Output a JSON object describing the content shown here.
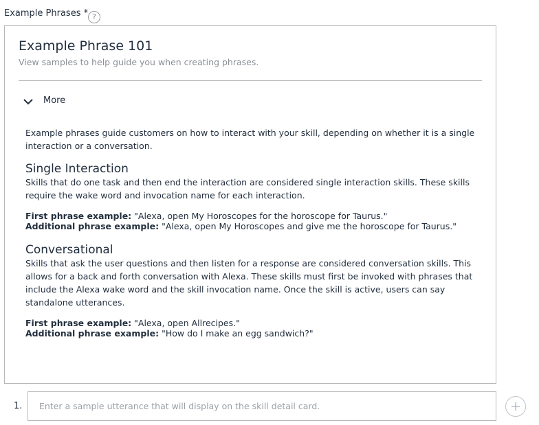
{
  "field": {
    "label": "Example Phrases *",
    "help_glyph": "?"
  },
  "panel": {
    "title": "Example Phrase 101",
    "subtitle": "View samples to help guide you when creating phrases.",
    "toggle_label": "More",
    "intro": "Example phrases guide customers on how to interact with your skill, depending on whether it is a single interaction or a conversation.",
    "sections": [
      {
        "heading": "Single Interaction",
        "body": "Skills that do one task and then end the interaction are considered single interaction skills. These skills require the wake word and invocation name for each interaction.",
        "first_label": "First phrase example:",
        "first_value": " \"Alexa, open My Horoscopes for the horoscope for Taurus.\"",
        "additional_label": "Additional phrase example:",
        "additional_value": " \"Alexa, open My Horoscopes and give me the horoscope for Taurus.\""
      },
      {
        "heading": "Conversational",
        "body": "Skills that ask the user questions and then listen for a response are considered conversation skills. This allows for a back and forth conversation with Alexa. These skills must first be invoked with phrases that include the Alexa wake word and the skill invocation name. Once the skill is active, users can say standalone utterances.",
        "first_label": "First phrase example:",
        "first_value": " \"Alexa, open Allrecipes.\"",
        "additional_label": "Additional phrase example:",
        "additional_value": " \"How do I make an egg sandwich?\""
      }
    ]
  },
  "utterance": {
    "number": "1.",
    "value": "",
    "placeholder": "Enter a sample utterance that will display on the skill detail card."
  },
  "icons": {
    "help": "help-circle-icon",
    "toggle": "chevron-down-icon",
    "add": "plus-circle-icon"
  },
  "colors": {
    "text": "#232f3e",
    "muted": "#8a8f96",
    "border": "#b8b8b8"
  }
}
